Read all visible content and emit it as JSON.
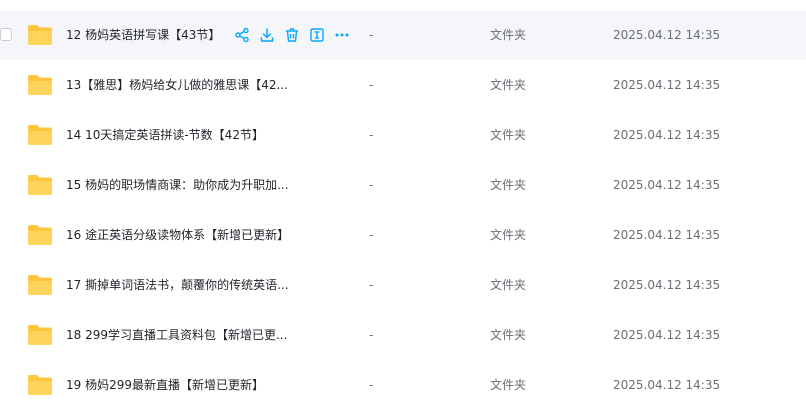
{
  "accent_color": "#06a7ff",
  "folder_color": "#ffc53d",
  "actions": [
    {
      "icon": "share-icon"
    },
    {
      "icon": "download-icon"
    },
    {
      "icon": "delete-icon"
    },
    {
      "icon": "rename-icon"
    },
    {
      "icon": "more-icon"
    }
  ],
  "files": [
    {
      "name": "12 杨妈英语拼写课【43节】",
      "size": "-",
      "type": "文件夹",
      "modified": "2025.04.12 14:35"
    },
    {
      "name": "13【雅思】杨妈给女儿做的雅思课【42...",
      "size": "-",
      "type": "文件夹",
      "modified": "2025.04.12 14:35"
    },
    {
      "name": "14 10天搞定英语拼读-节数【42节】",
      "size": "-",
      "type": "文件夹",
      "modified": "2025.04.12 14:35"
    },
    {
      "name": "15 杨妈的职场情商课：助你成为升职加...",
      "size": "-",
      "type": "文件夹",
      "modified": "2025.04.12 14:35"
    },
    {
      "name": "16 途正英语分级读物体系【新增已更新】",
      "size": "-",
      "type": "文件夹",
      "modified": "2025.04.12 14:35"
    },
    {
      "name": "17 撕掉单词语法书，颠覆你的传统英语...",
      "size": "-",
      "type": "文件夹",
      "modified": "2025.04.12 14:35"
    },
    {
      "name": "18 299学习直播工具资料包【新增已更...",
      "size": "-",
      "type": "文件夹",
      "modified": "2025.04.12 14:35"
    },
    {
      "name": "19 杨妈299最新直播【新增已更新】",
      "size": "-",
      "type": "文件夹",
      "modified": "2025.04.12 14:35"
    }
  ]
}
